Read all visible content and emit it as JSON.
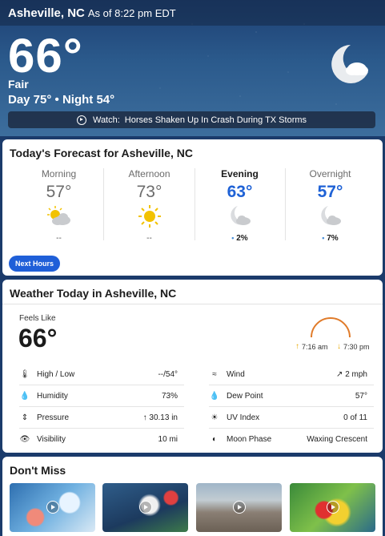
{
  "header": {
    "location": "Asheville, NC",
    "as_of": "As of 8:22 pm EDT"
  },
  "current": {
    "temp": "66°",
    "phrase": "Fair",
    "day_night": "Day 75° • Night 54°",
    "icon": "moon-cloud-icon"
  },
  "watch": {
    "label": "Watch:",
    "headline": "Horses Shaken Up In Crash During TX Storms"
  },
  "forecast": {
    "title": "Today's Forecast for Asheville, NC",
    "periods": [
      {
        "name": "Morning",
        "temp": "57°",
        "icon": "partly-cloudy-icon",
        "precip": "--"
      },
      {
        "name": "Afternoon",
        "temp": "73°",
        "icon": "sunny-icon",
        "precip": "--"
      },
      {
        "name": "Evening",
        "temp": "63°",
        "icon": "night-cloud-icon",
        "precip": "2%"
      },
      {
        "name": "Overnight",
        "temp": "57°",
        "icon": "night-cloud-icon",
        "precip": "7%"
      }
    ],
    "next_hours_label": "Next Hours"
  },
  "today": {
    "title": "Weather Today in Asheville, NC",
    "feels_like_label": "Feels Like",
    "feels_like": "66°",
    "sunrise": "7:16 am",
    "sunset": "7:30 pm",
    "left_details": [
      {
        "icon": "thermometer-icon",
        "label": "High / Low",
        "value": "--/54°"
      },
      {
        "icon": "humidity-icon",
        "label": "Humidity",
        "value": "73%"
      },
      {
        "icon": "pressure-icon",
        "label": "Pressure",
        "value": "30.13 in"
      },
      {
        "icon": "visibility-icon",
        "label": "Visibility",
        "value": "10 mi"
      }
    ],
    "right_details": [
      {
        "icon": "wind-icon",
        "label": "Wind",
        "value": "2 mph"
      },
      {
        "icon": "dew-point-icon",
        "label": "Dew Point",
        "value": "57°"
      },
      {
        "icon": "uv-index-icon",
        "label": "UV Index",
        "value": "0 of 11"
      },
      {
        "icon": "moon-phase-icon",
        "label": "Moon Phase",
        "value": "Waxing Crescent"
      }
    ]
  },
  "dont_miss": {
    "title": "Don't Miss",
    "items": [
      {
        "name": "video-thumb-weather-map"
      },
      {
        "name": "video-thumb-hurricane-satellite"
      },
      {
        "name": "video-thumb-storm-damage"
      },
      {
        "name": "video-thumb-radar-map"
      }
    ]
  },
  "colors": {
    "accent_blue": "#1f62d6",
    "sun_yellow": "#f2c200"
  }
}
